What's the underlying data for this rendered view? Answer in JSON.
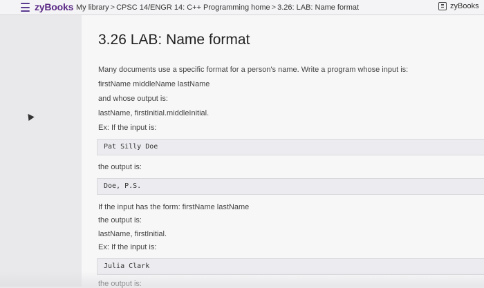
{
  "header": {
    "logo": "zyBooks",
    "breadcrumbs": [
      "My library",
      "CPSC 14/ENGR 14: C++ Programming home",
      "3.26: LAB: Name format"
    ],
    "right_label": "zyBooks"
  },
  "main": {
    "title": "3.26 LAB: Name format",
    "lines": [
      "Many documents use a specific format for a person's name. Write a program whose input is:",
      "firstName middleName lastName",
      "and whose output is:",
      "lastName, firstInitial.middleInitial.",
      "Ex: If the input is:",
      "the output is:",
      "If the input has the form: firstName lastName",
      "the output is:",
      "lastName, firstInitial.",
      "Ex: If the input is:",
      "the output is:"
    ],
    "code": [
      "Pat Silly Doe",
      "Doe, P.S.",
      "Julia Clark"
    ]
  }
}
